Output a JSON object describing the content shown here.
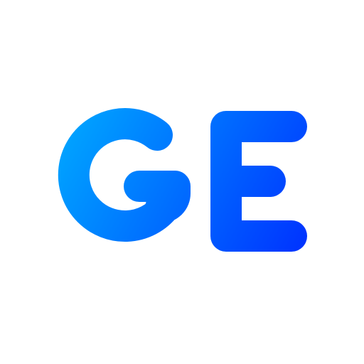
{
  "logo": {
    "text": "GE",
    "gradient_start": "#00AAFF",
    "gradient_end": "#0033FF",
    "background": "#FFFFFF"
  }
}
